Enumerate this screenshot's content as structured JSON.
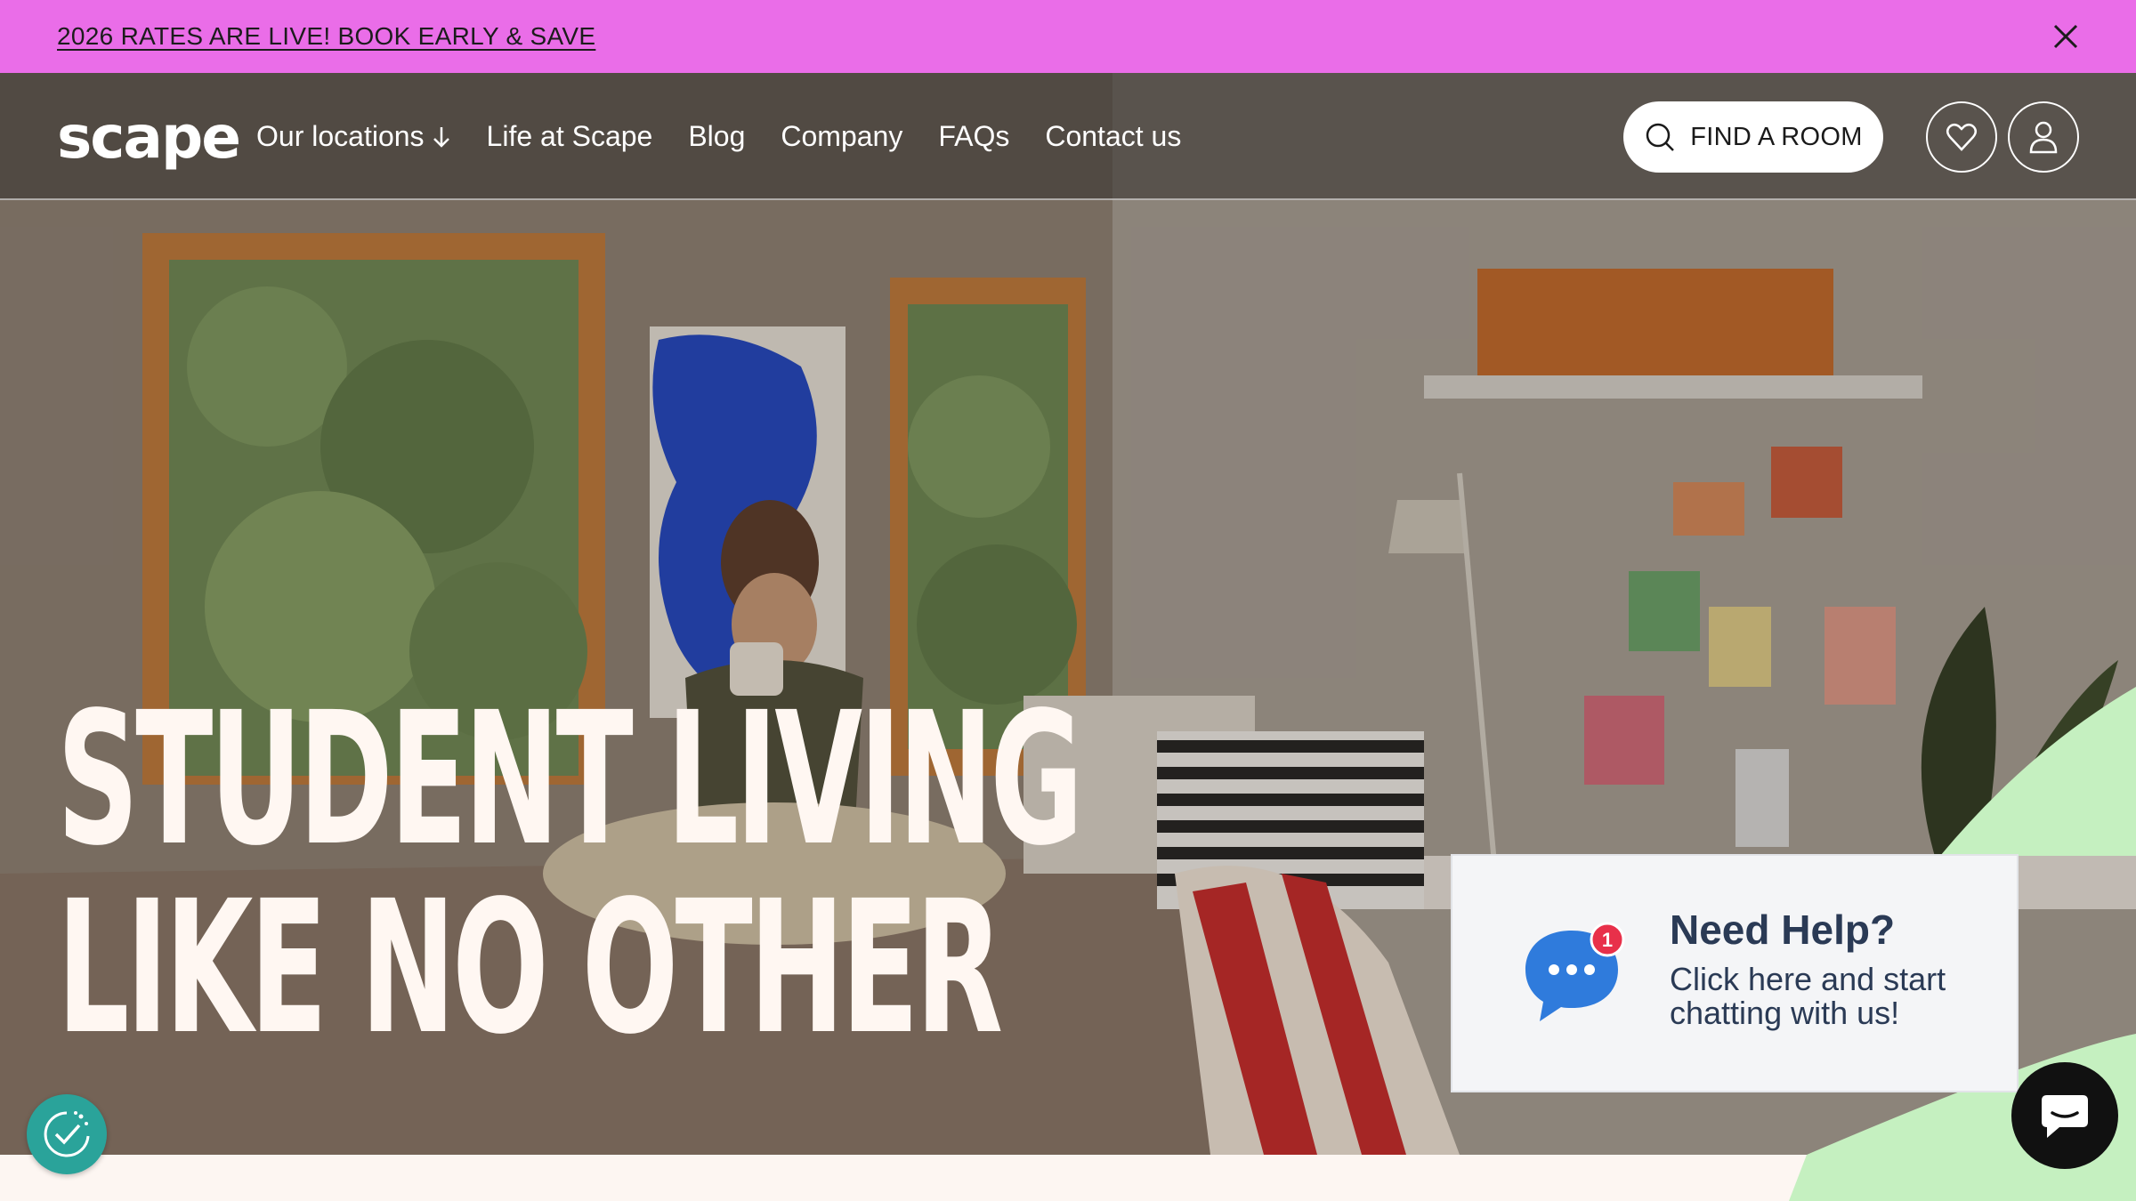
{
  "promo": {
    "text": "2026 RATES ARE LIVE! BOOK EARLY & SAVE"
  },
  "header": {
    "logo": "scape",
    "nav": [
      {
        "label": "Our locations"
      },
      {
        "label": "Life at Scape"
      },
      {
        "label": "Blog"
      },
      {
        "label": "Company"
      },
      {
        "label": "FAQs"
      },
      {
        "label": "Contact us"
      }
    ],
    "find_room_label": "FIND A ROOM"
  },
  "hero": {
    "headline_line1": "STUDENT LIVING",
    "headline_line2": "LIKE NO OTHER"
  },
  "help": {
    "title": "Need Help?",
    "subtitle": "Click here and start chatting with us!",
    "badge": "1"
  },
  "colors": {
    "promo_bg": "#ea6de8",
    "accent_green": "#c5f0c0",
    "chat_blue": "#2f7bdc",
    "cookie_teal": "#2aa39a"
  }
}
